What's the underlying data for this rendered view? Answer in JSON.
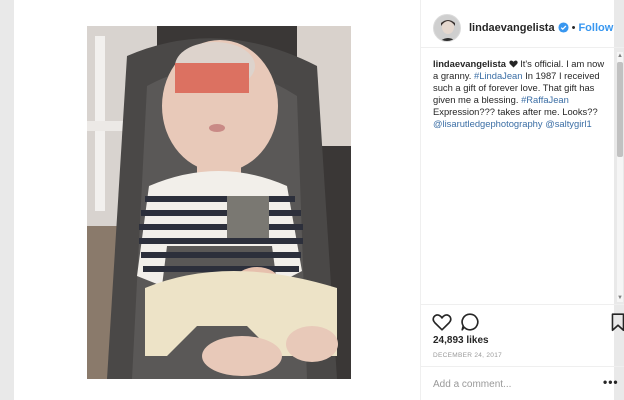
{
  "post": {
    "username": "lindaevangelista",
    "follow_separator": "•",
    "follow_label": "Follow",
    "caption": {
      "username": "lindaevangelista",
      "text_1": " It's official. I am now a granny. ",
      "tag_1": "#LindaJean",
      "text_2": " In 1987 I received such a gift of forever love. That gift has given me a blessing. ",
      "tag_2": "#RaffaJean",
      "text_3": " Expression??? takes after me. Looks?? ",
      "mention_1": "@lisarutledgephotography",
      "mention_2": "@saltygirl1"
    },
    "likes": "24,893 likes",
    "date": "DECEMBER 24, 2017",
    "comment_placeholder": "Add a comment...",
    "more_label": "•••"
  },
  "icons": {
    "verified": "verified-badge-icon",
    "like": "heart-icon",
    "comment": "comment-bubble-icon",
    "save": "bookmark-icon",
    "more": "more-options-icon"
  },
  "colors": {
    "link": "#3897f0",
    "hashtag": "#3b6ea5",
    "muted": "#999999",
    "border": "#efefef"
  }
}
